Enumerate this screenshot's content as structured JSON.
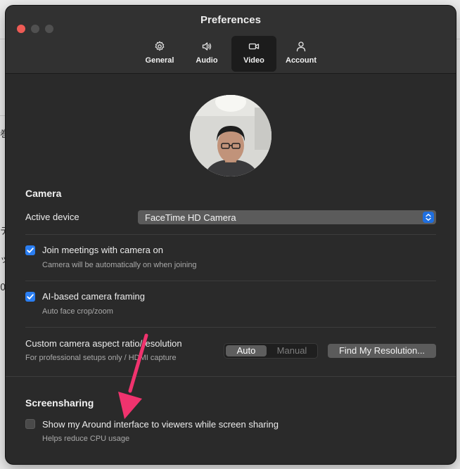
{
  "window": {
    "title": "Preferences"
  },
  "tabs": [
    {
      "label": "General",
      "icon": "gear-icon",
      "active": false
    },
    {
      "label": "Audio",
      "icon": "speaker-icon",
      "active": false
    },
    {
      "label": "Video",
      "icon": "video-camera-icon",
      "active": true
    },
    {
      "label": "Account",
      "icon": "person-icon",
      "active": false
    }
  ],
  "camera": {
    "section_title": "Camera",
    "active_device_label": "Active device",
    "active_device_value": "FaceTime HD Camera",
    "join_with_camera": {
      "label": "Join meetings with camera on",
      "description": "Camera will be automatically on when joining",
      "checked": true
    },
    "ai_framing": {
      "label": "AI-based camera framing",
      "description": "Auto face crop/zoom",
      "checked": true
    },
    "aspect_ratio": {
      "label": "Custom camera aspect ratio/resolution",
      "description": "For professional setups only / HDMI capture",
      "options": [
        "Auto",
        "Manual"
      ],
      "selected": "Auto",
      "find_button": "Find My Resolution..."
    }
  },
  "screensharing": {
    "section_title": "Screensharing",
    "show_interface": {
      "label": "Show my Around interface to viewers while screen sharing",
      "description": "Helps reduce CPU usage",
      "checked": false
    }
  },
  "colors": {
    "window_bg": "#2a2a2a",
    "accent": "#2a7ef2",
    "close_button": "#ee5b55",
    "annotation_arrow": "#f0336e"
  }
}
